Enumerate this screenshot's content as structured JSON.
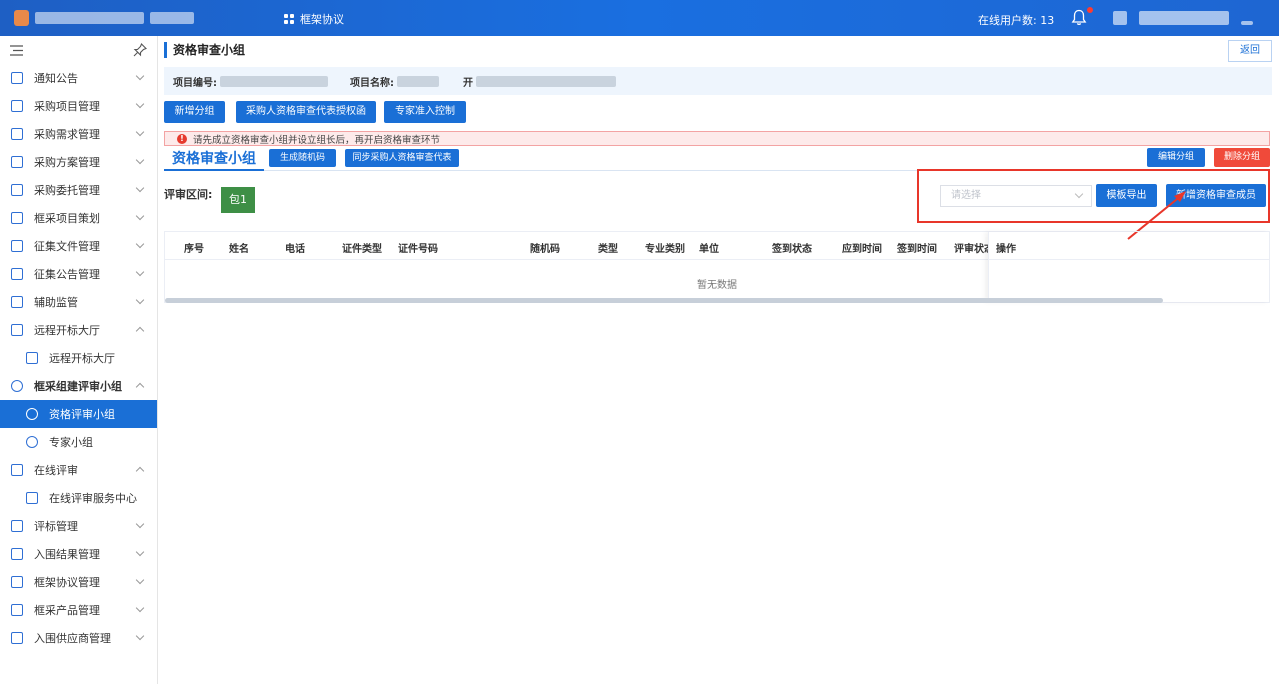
{
  "header": {
    "menu_label": "框架协议",
    "online_users_label": "在线用户数: 13"
  },
  "sidebar": {
    "items": [
      {
        "label": "通知公告"
      },
      {
        "label": "采购项目管理"
      },
      {
        "label": "采购需求管理"
      },
      {
        "label": "采购方案管理"
      },
      {
        "label": "采购委托管理"
      },
      {
        "label": "框采项目策划"
      },
      {
        "label": "征集文件管理"
      },
      {
        "label": "征集公告管理"
      },
      {
        "label": "辅助监管"
      },
      {
        "label": "远程开标大厅"
      },
      {
        "label": "远程开标大厅"
      },
      {
        "label": "框采组建评审小组"
      },
      {
        "label": "资格评审小组"
      },
      {
        "label": "专家小组"
      },
      {
        "label": "在线评审"
      },
      {
        "label": "在线评审服务中心"
      },
      {
        "label": "评标管理"
      },
      {
        "label": "入围结果管理"
      },
      {
        "label": "框架协议管理"
      },
      {
        "label": "框采产品管理"
      },
      {
        "label": "入围供应商管理"
      }
    ]
  },
  "page": {
    "title": "资格审查小组",
    "back_label": "返回",
    "project_no_label": "项目编号:",
    "project_name_label": "项目名称:",
    "extra_label_char": "开"
  },
  "toolbar": {
    "add_group": "新增分组",
    "purchaser_auth": "采购人资格审查代表授权函",
    "expert_control": "专家准入控制"
  },
  "warning": {
    "icon": "!",
    "text": "请先成立资格审查小组并设立组长后，再开启资格审查环节"
  },
  "tab": {
    "title": "资格审查小组",
    "gen_random": "生成随机码",
    "sync_rep": "同步采购人资格审查代表",
    "edit_group": "编辑分组",
    "delete_group": "删除分组"
  },
  "review": {
    "range_label": "评审区间:",
    "package": "包1",
    "select_placeholder": "请选择",
    "template_export": "模板导出",
    "add_member": "新增资格审查成员"
  },
  "table": {
    "columns": [
      "序号",
      "姓名",
      "电话",
      "证件类型",
      "证件号码",
      "随机码",
      "类型",
      "专业类别",
      "单位",
      "签到状态",
      "应到时间",
      "签到时间",
      "评审状态",
      "操作"
    ],
    "empty_text": "暂无数据"
  },
  "colors": {
    "primary": "#1a6fd6",
    "danger": "#f04a3a",
    "package_green": "#3e8f46",
    "highlight_red": "#e8362a"
  }
}
